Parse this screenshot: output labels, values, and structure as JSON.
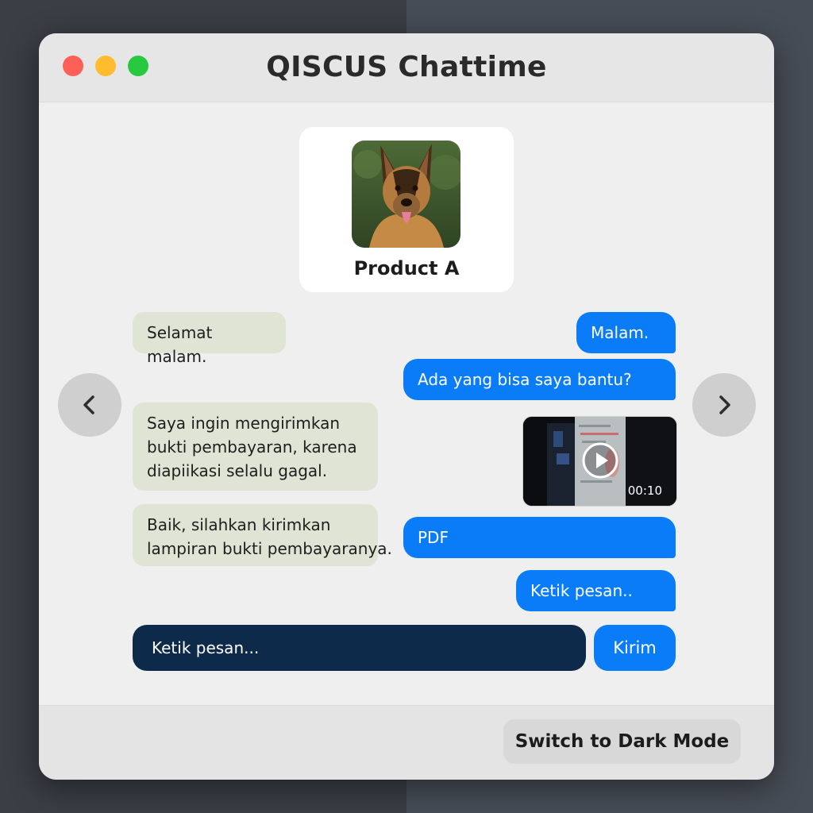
{
  "window": {
    "title": "QISCUS Chattime"
  },
  "product": {
    "name": "Product A"
  },
  "messages": {
    "m1": "Selamat malam.",
    "m2": "Malam.",
    "m3": "Ada yang bisa saya bantu?",
    "m4": "Saya ingin mengirimkan\nbukti pembayaran, karena\ndiapiikasi selalu gagal.",
    "m5": "Baik, silahkan kirimkan\nlampiran bukti pembayaranya.",
    "m6": "PDF",
    "m7": "Ketik pesan.."
  },
  "video": {
    "duration": "00:10"
  },
  "composer": {
    "placeholder": "Ketik pesan...",
    "send_label": "Kirim"
  },
  "footer": {
    "dark_mode_label": "Switch to Dark Mode"
  },
  "colors": {
    "accent": "#0a7cf7",
    "incoming_bubble": "#dfe4d5",
    "composer_bg": "#0e2a4a"
  },
  "icons": {
    "prev": "chevron-left-icon",
    "next": "chevron-right-icon",
    "play": "play-icon"
  }
}
